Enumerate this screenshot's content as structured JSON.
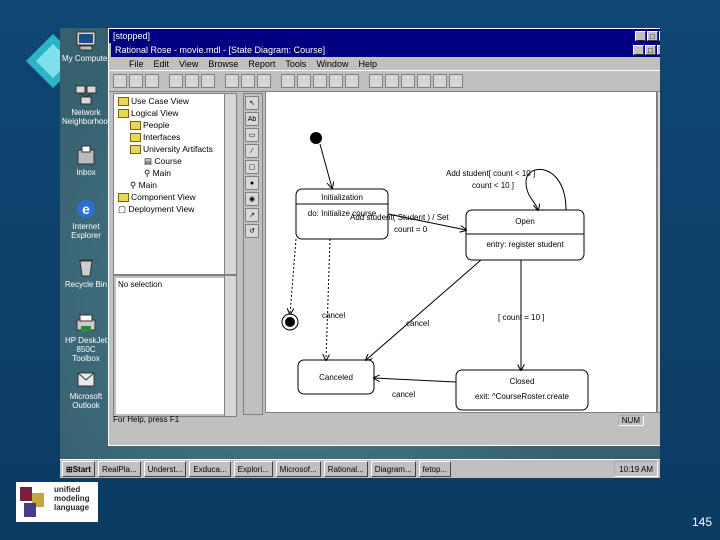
{
  "desktop_icons": [
    {
      "label": "My Computer",
      "icon": "computer-icon"
    },
    {
      "label": "Network Neighborhood",
      "icon": "network-icon"
    },
    {
      "label": "Inbox",
      "icon": "inbox-icon"
    },
    {
      "label": "Internet Explorer",
      "icon": "internet-explorer-icon"
    },
    {
      "label": "Recycle Bin",
      "icon": "recycle-bin-icon"
    },
    {
      "label": "HP DeskJet 850C Toolbox",
      "icon": "printer-icon"
    },
    {
      "label": "Microsoft Outlook",
      "icon": "outlook-icon"
    }
  ],
  "outer_window": {
    "title": "[stopped]"
  },
  "app_window": {
    "title": "Rational Rose - movie.mdl - [State Diagram: Course]"
  },
  "menu": [
    "File",
    "Edit",
    "View",
    "Browse",
    "Report",
    "Tools",
    "Window",
    "Help"
  ],
  "tree": [
    {
      "label": "Use Case View",
      "indent": 0,
      "folder": true
    },
    {
      "label": "Logical View",
      "indent": 0,
      "folder": true
    },
    {
      "label": "People",
      "indent": 1,
      "folder": true
    },
    {
      "label": "Interfaces",
      "indent": 1,
      "folder": true
    },
    {
      "label": "University Artifacts",
      "indent": 1,
      "folder": true
    },
    {
      "label": "Course",
      "indent": 2,
      "folder": false
    },
    {
      "label": "Main",
      "indent": 2,
      "folder": false
    },
    {
      "label": "Main",
      "indent": 1,
      "folder": false
    },
    {
      "label": "Component View",
      "indent": 0,
      "folder": true
    },
    {
      "label": "Deployment View",
      "indent": 0,
      "folder": false
    }
  ],
  "doc_pane": {
    "text": "No selection"
  },
  "palette": [
    "arrow",
    "ABC",
    "note",
    "anchor",
    "state",
    "start",
    "end",
    "transition",
    "loop"
  ],
  "diagram": {
    "states": {
      "initialization": {
        "name": "Initialization",
        "action": "do: Initialize course"
      },
      "open": {
        "name": "Open",
        "action": "entry: register student"
      },
      "canceled": {
        "name": "Canceled"
      },
      "closed": {
        "name": "Closed",
        "action": "exit: ^CourseRoster.create"
      }
    },
    "transitions": {
      "add_student_guard": "Add student[ count < 10 ]",
      "add_student_set": "Add student( Student ) / Set",
      "count_zero": "count = 0",
      "cancel1": "cancel",
      "cancel2": "cancel",
      "cancel3": "cancel",
      "count_10": "[ count = 10 ]",
      "add_student_guard2": "count < 10 ]"
    }
  },
  "status_bar": {
    "help_text": "For Help, press F1",
    "num": "NUM"
  },
  "taskbar": {
    "start": "Start",
    "tasks": [
      "RealPla...",
      "Underst...",
      "Exduca...",
      "Explori...",
      "Microsof...",
      "Rational...",
      "Diagram...",
      "fetop..."
    ],
    "clock": "10:19 AM"
  },
  "logo": {
    "line1": "unified",
    "line2": "modeling",
    "line3": "language"
  },
  "page_number": "145"
}
